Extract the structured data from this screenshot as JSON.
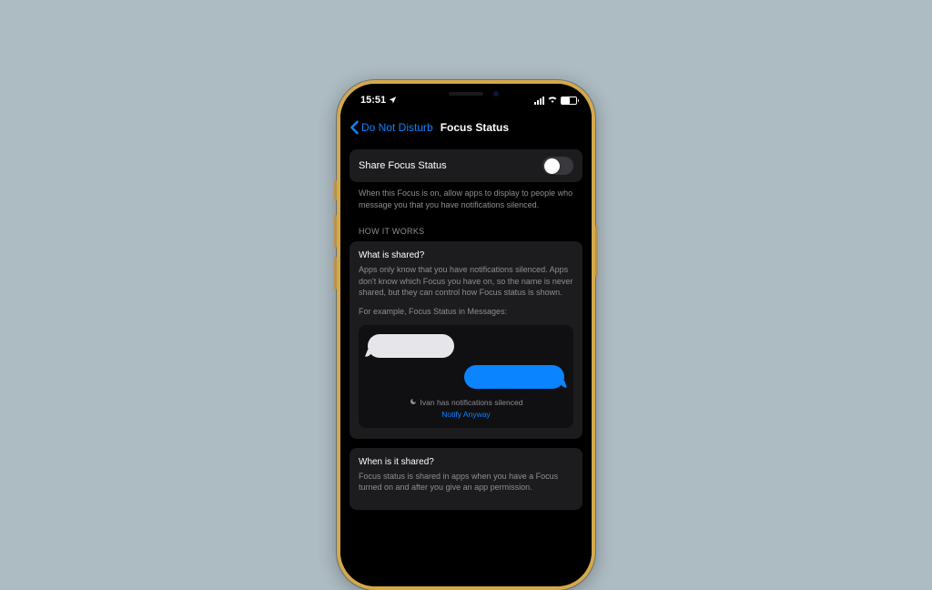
{
  "statusBar": {
    "time": "15:51",
    "locationIcon": "location-arrow"
  },
  "nav": {
    "backLabel": "Do Not Disturb",
    "title": "Focus Status"
  },
  "shareRow": {
    "label": "Share Focus Status",
    "enabled": false,
    "footer": "When this Focus is on, allow apps to display to people who message you that you have notifications silenced."
  },
  "howItWorks": {
    "header": "HOW IT WORKS",
    "card1": {
      "title": "What is shared?",
      "body": "Apps only know that you have notifications silenced. Apps don't know which Focus you have on, so the name is never shared, but they can control how Focus status is shown.",
      "exampleLabel": "For example, Focus Status in Messages:",
      "silencedText": "Ivan has notifications silenced",
      "notifyAnyway": "Notify Anyway"
    },
    "card2": {
      "title": "When is it shared?",
      "body": "Focus status is shared in apps when you have a Focus turned on and after you give an app permission."
    }
  }
}
